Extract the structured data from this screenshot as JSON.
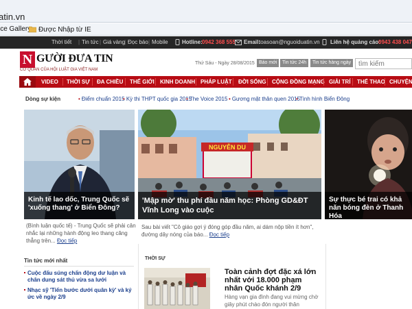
{
  "browser": {
    "url_fragment": "atin.vn",
    "favorites": [
      "ice Gallery",
      "Được Nhập từ IE"
    ]
  },
  "top_strip": {
    "items": [
      "Thời tiết",
      "Tin tức",
      "Giá vàng",
      "Đọc báo",
      "Mobile"
    ],
    "hotline_label": "Hotline:",
    "hotline": "0942 368 555",
    "email_label": "Email:",
    "email": "toasoan@nguoiduatin.vn",
    "ads_label": "Liên hệ quảng cáo:",
    "ads_phone": "0943 438 047"
  },
  "logo": {
    "letter": "N",
    "rest": "GƯỜI ĐƯA TIN",
    "subtitle": "CƠ QUAN CỦA HỘI LUẬT GIA VIỆT NAM"
  },
  "header": {
    "date": "Thứ Sáu - Ngày 28/08/2015",
    "buttons": [
      "Báo mới",
      "Tin tức 24h",
      "Tin tức hàng ngày"
    ],
    "search_placeholder": "tìm kiếm"
  },
  "nav": [
    "VIDEO",
    "THỜI SỰ",
    "ĐA CHIỀU",
    "THẾ GIỚI",
    "KINH DOANH",
    "PHÁP LUẬT",
    "ĐỜI SỐNG",
    "CỘNG ĐỒNG MẠNG",
    "GIẢI TRÍ",
    "THỂ THAO",
    "CHUYỆN"
  ],
  "events": {
    "label": "Dòng sự kiện",
    "items": [
      "Điểm chuẩn 2015",
      "Kỳ thi THPT quốc gia 2015",
      "The Voice 2015",
      "Gương mặt thân quen 2015",
      "Tình hình Biển Đông"
    ]
  },
  "stories": {
    "left": {
      "title": "Kinh tế lao dốc, Trung Quốc sẽ 'xuống thang' ở Biển Đông?",
      "sapo": "(Bình luận quốc tế) - Trung Quốc sẽ phải cân nhắc lại những hành động leo thang căng thẳng trên...",
      "more": "Đọc tiếp"
    },
    "center": {
      "title": "'Mập mờ' thu phí đầu năm học: Phòng GD&ĐT Vĩnh Long vào cuộc",
      "sapo": "Sau bài viết \"Cô giáo gợi ý đóng góp đầu năm, ai dám nộp tiền ít hơn\", đường dây nóng của báo...",
      "more": "Đọc tiếp",
      "sign": "NGUYỄN DU"
    },
    "right": {
      "title": "Sự thực bé trai có khả năn bóng đèn ở Thanh Hóa"
    }
  },
  "latest": {
    "heading": "Tin tức mới nhất",
    "items": [
      "Cuộc đấu súng chấn động dư luận và chân dung sát thủ vừa sa lưới",
      "Nhạc sỹ 'Tiến bước dưới quân kỳ' và ký ức về ngày 2/9"
    ]
  },
  "thoisu": {
    "heading": "THỜI SỰ",
    "title": "Toàn cảnh đợt đặc xá lớn nhất với 18.000 phạm nhân Quốc khánh 2/9",
    "sapo": "Hàng vạn gia đình đang vui mừng chờ giây phút chào đón người thân"
  }
}
